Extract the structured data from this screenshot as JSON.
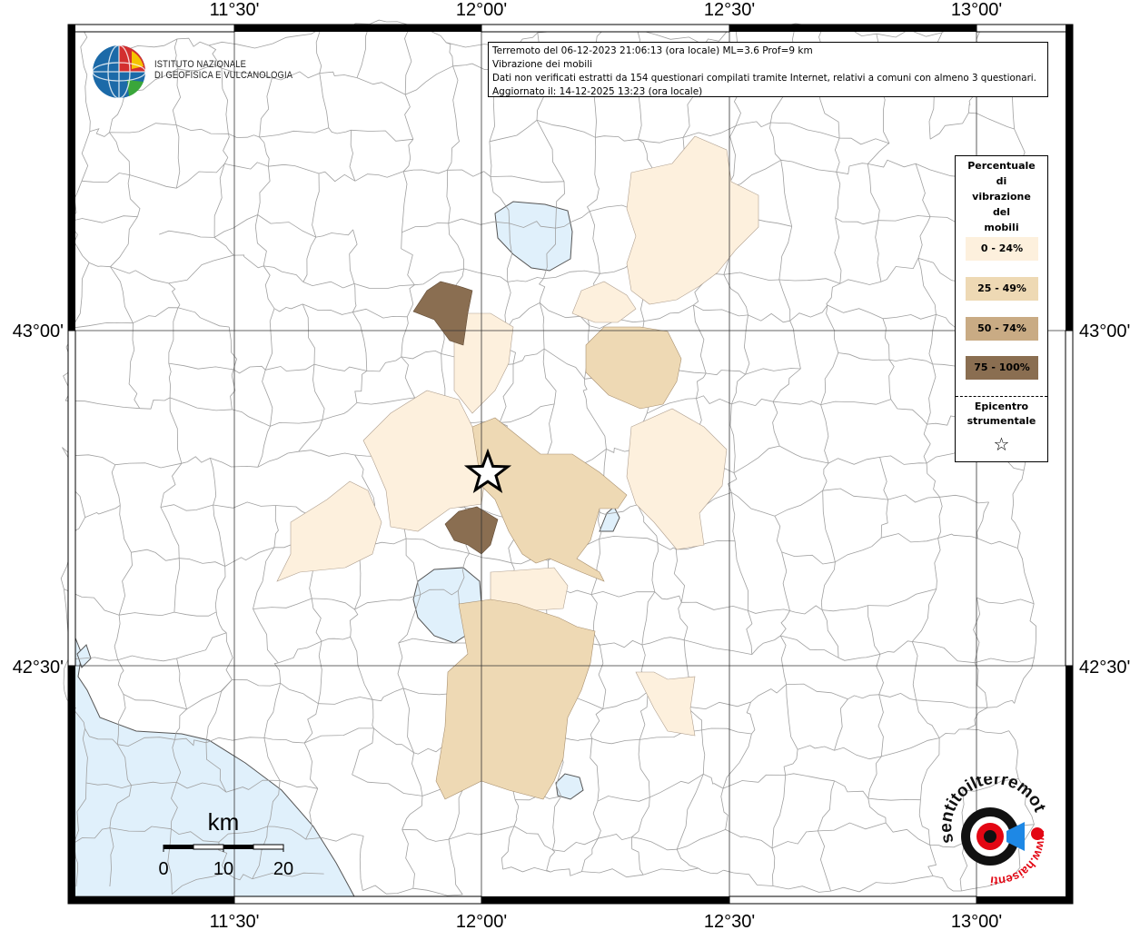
{
  "info": {
    "line1": "Terremoto del 06-12-2023 21:06:13 (ora locale) ML=3.6 Prof=9 km",
    "line2": "Vibrazione dei mobili",
    "line3": "Dati non verificati estratti da 154 questionari compilati tramite Internet, relativi a comuni con almeno 3 questionari.",
    "line4": "Aggiornato il: 14-12-2025 13:23 (ora locale)"
  },
  "logo": {
    "line1": "ISTITUTO NAZIONALE",
    "line2": "DI GEOFISICA E VULCANOLOGIA"
  },
  "legend": {
    "title_lines": [
      "Percentuale",
      "di",
      "vibrazione",
      "del",
      "mobili"
    ],
    "classes": [
      {
        "label": "0 - 24%",
        "color": "#fdf0dd"
      },
      {
        "label": "25 - 49%",
        "color": "#eed9b4"
      },
      {
        "label": "50 - 74%",
        "color": "#c9ab84"
      },
      {
        "label": "75 - 100%",
        "color": "#8a6e51"
      }
    ],
    "epicenter_line1": "Epicentro",
    "epicenter_line2": "strumentale",
    "epicenter_symbol": "☆"
  },
  "axes": {
    "lon_labels": [
      "11°30'",
      "12°00'",
      "12°30'",
      "13°00'"
    ],
    "lat_labels": [
      "43°00'",
      "42°30'"
    ]
  },
  "scalebar": {
    "unit": "km",
    "ticks": [
      "0",
      "10",
      "20"
    ]
  },
  "badge": {
    "text_top": "sentitoilterremoto.it",
    "text_bottom": "www.haisentito",
    "accent": "#e30613",
    "dark": "#111111",
    "blue": "#1e88e5"
  },
  "colors": {
    "water": "#e0f0fb",
    "boundaries": "#9a9a9a",
    "grid": "#333333",
    "frame": "#000000"
  }
}
